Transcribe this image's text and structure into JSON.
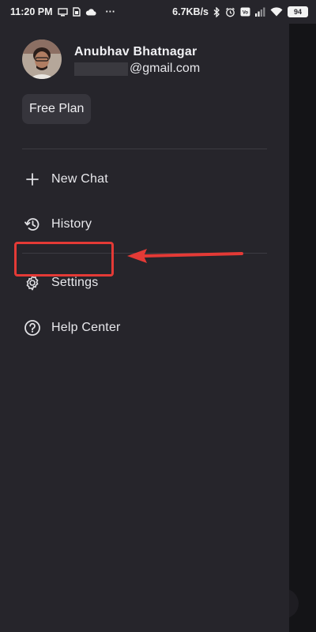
{
  "status_bar": {
    "time": "11:20 PM",
    "more": "···",
    "network_speed": "6.7KB/s",
    "battery": "94"
  },
  "profile": {
    "name": "Anubhav Bhatnagar",
    "email_visible": "@gmail.com"
  },
  "plan": {
    "label": "Free Plan"
  },
  "menu": {
    "items": [
      {
        "label": "New Chat",
        "icon": "plus-icon"
      },
      {
        "label": "History",
        "icon": "history-icon"
      },
      {
        "label": "Settings",
        "icon": "gear-icon"
      },
      {
        "label": "Help Center",
        "icon": "question-circle-icon"
      }
    ]
  },
  "annotation": {
    "color": "#e43a36",
    "target": "Settings"
  },
  "colors": {
    "drawer_bg": "#26252b",
    "screen_bg": "#111114",
    "text": "#e8e8ec",
    "badge_bg": "#36353c"
  }
}
